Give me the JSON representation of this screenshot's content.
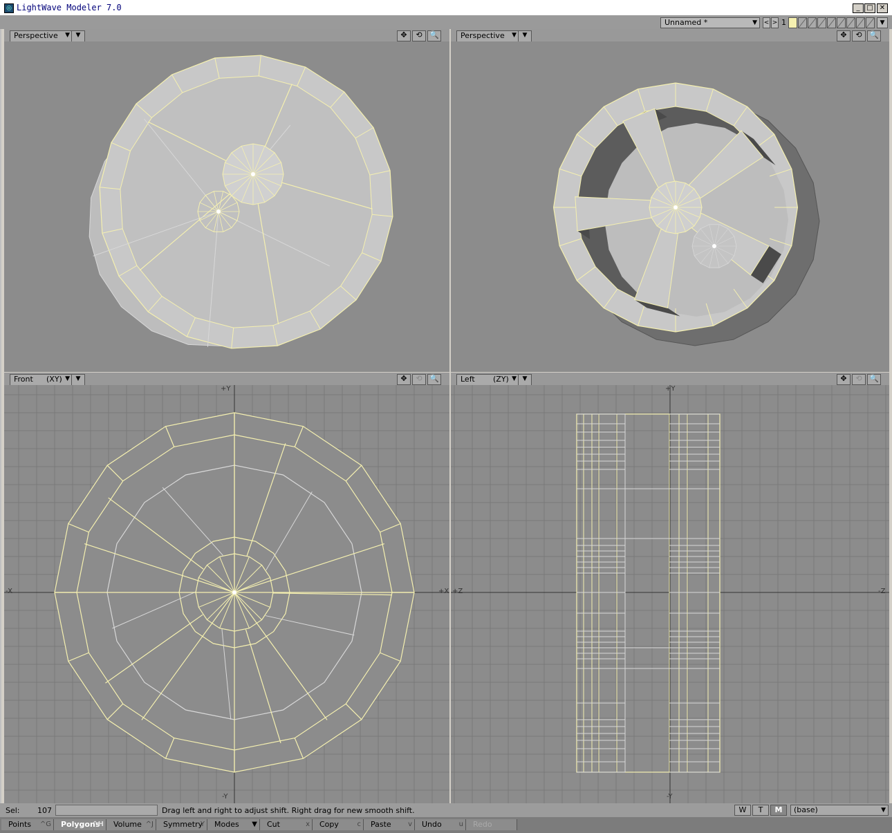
{
  "window": {
    "title": "LightWave Modeler 7.0",
    "icon": "lightwave-icon",
    "controls": [
      "_",
      "□",
      "✕"
    ]
  },
  "topbar": {
    "object_name": "Unnamed *",
    "prev_label": "<",
    "next_label": ">",
    "layer_number": "1"
  },
  "viewports": {
    "top_left": {
      "view": "Perspective",
      "tools": [
        "✥",
        "⟲",
        "🔍"
      ]
    },
    "top_right": {
      "view": "Perspective",
      "tools": [
        "✥",
        "⟲",
        "🔍"
      ]
    },
    "bottom_left": {
      "view": "Front",
      "plane": "(XY)",
      "axes": {
        "top": "+Y",
        "bottom": "-Y",
        "left": "-X",
        "right": "+X"
      },
      "tools": [
        "✥",
        "⟲",
        "🔍"
      ]
    },
    "bottom_right": {
      "view": "Left",
      "plane": "(ZY)",
      "axes": {
        "top": "+Y",
        "bottom": "-Y",
        "left": "+Z",
        "right": "-Z"
      },
      "tools": [
        "✥",
        "⟲",
        "🔍"
      ]
    }
  },
  "status": {
    "sel_label": "Sel:",
    "sel_count": "107",
    "hint": "Drag left and right to adjust shift. Right drag for new smooth shift.",
    "modes": [
      "W",
      "T",
      "M"
    ],
    "layer": "(base)"
  },
  "toolbar": {
    "points": {
      "label": "Points",
      "shortcut": "^G"
    },
    "polygons": {
      "label": "Polygons",
      "shortcut": "^H"
    },
    "volume": {
      "label": "Volume",
      "shortcut": "^J"
    },
    "symmetry": {
      "label": "Symmetry",
      "shortcut": "Y"
    },
    "modes": {
      "label": "Modes"
    },
    "cut": {
      "label": "Cut",
      "shortcut": "x"
    },
    "copy": {
      "label": "Copy",
      "shortcut": "c"
    },
    "paste": {
      "label": "Paste",
      "shortcut": "v"
    },
    "undo": {
      "label": "Undo",
      "shortcut": "u"
    },
    "redo": {
      "label": "Redo"
    }
  },
  "colors": {
    "wire_selected": "#f5f0b0",
    "wire_unselected": "#d8d8d8",
    "surface": "#c8c8c8",
    "viewport_bg": "#8c8c8c",
    "grid": "#7a7a7a"
  }
}
